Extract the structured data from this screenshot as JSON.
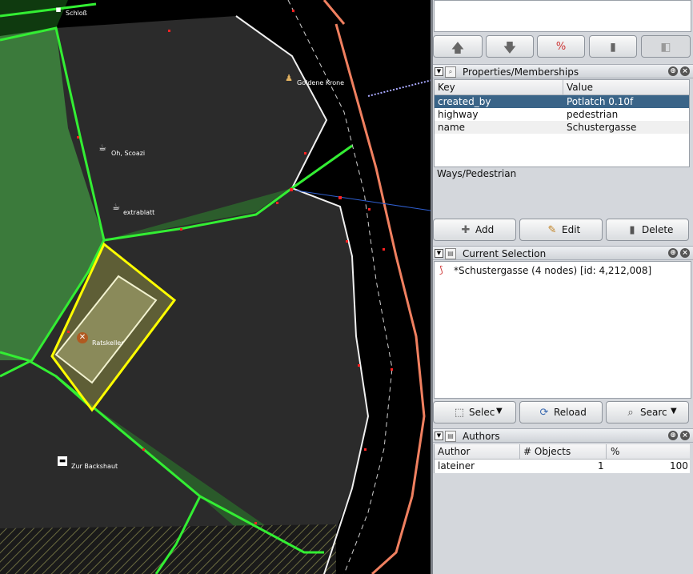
{
  "map": {
    "poi_labels": {
      "schloss": "Schloß",
      "goldene_krone": "Goldene Krone",
      "oh_scoazi": "Oh, Scoazi",
      "extrablatt": "extrablatt",
      "ratskeller": "Ratskeller",
      "zur_backshaut": "Zur Backshaut"
    },
    "colors": {
      "background": "#000000",
      "area_fill": "#2a2a2a",
      "forest_fill": "#1f5a1f",
      "green_way": "#33ee33",
      "white_way": "#f0f0f0",
      "salmon_way": "#f08060",
      "selected_way": "#ffff00",
      "node": "#ff2222"
    }
  },
  "toolbar": {
    "move_up_icon": "arrow-up-icon",
    "move_down_icon": "arrow-down-icon",
    "filter_icon": "filter-icon",
    "delete_icon": "trash-icon",
    "download_icon": "download-icon"
  },
  "properties": {
    "title": "Properties/Memberships",
    "columns": [
      "Key",
      "Value"
    ],
    "rows": [
      {
        "key": "created_by",
        "value": "Potlatch 0.10f",
        "selected": true
      },
      {
        "key": "highway",
        "value": "pedestrian"
      },
      {
        "key": "name",
        "value": "Schustergasse"
      }
    ],
    "membership": "Ways/Pedestrian",
    "buttons": {
      "add": "Add",
      "edit": "Edit",
      "delete": "Delete"
    }
  },
  "selection": {
    "title": "Current Selection",
    "items": [
      "*Schustergasse (4 nodes) [id: 4,212,008]"
    ],
    "buttons": {
      "select": "Selec",
      "reload": "Reload",
      "search": "Searc"
    }
  },
  "authors": {
    "title": "Authors",
    "columns": [
      "Author",
      "# Objects",
      "%"
    ],
    "rows": [
      {
        "author": "lateiner",
        "objects": "1",
        "percent": "100"
      }
    ]
  }
}
